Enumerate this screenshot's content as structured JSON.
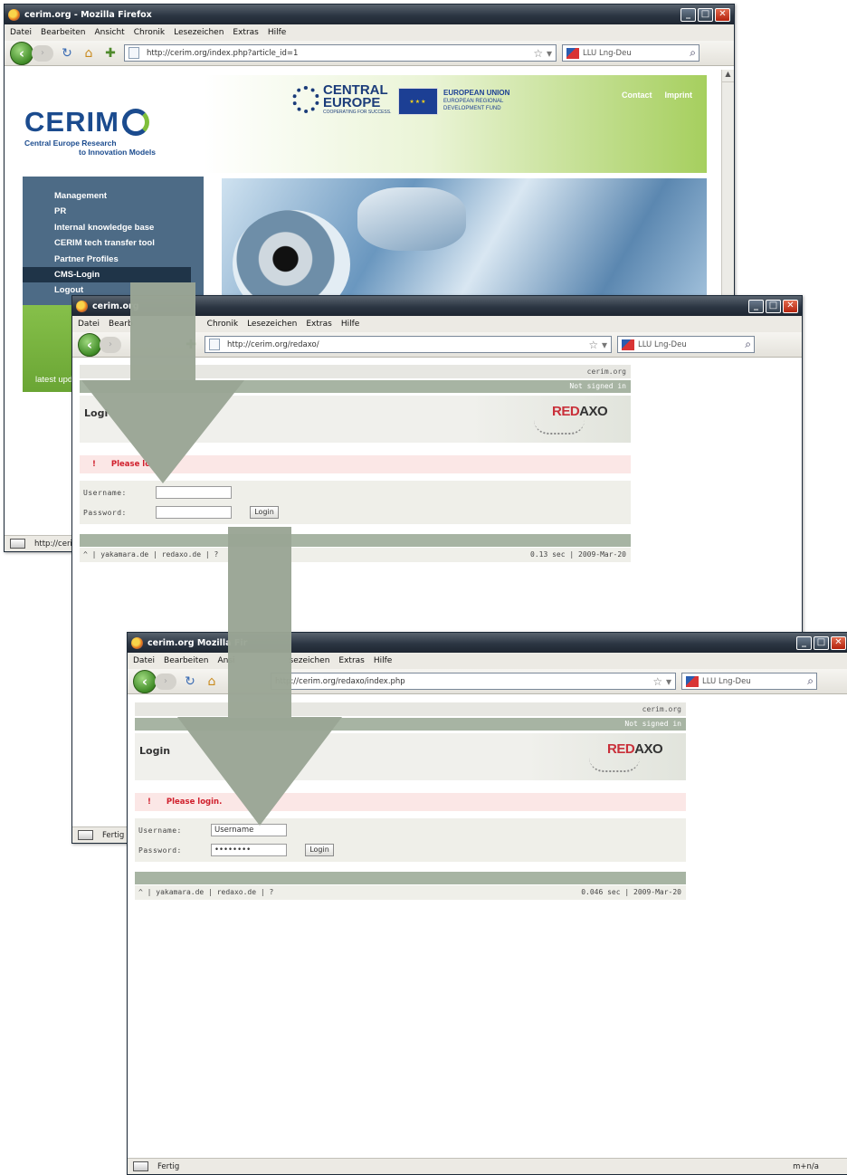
{
  "win1": {
    "title": "cerim.org - Mozilla Firefox",
    "menu": [
      "Datei",
      "Bearbeiten",
      "Ansicht",
      "Chronik",
      "Lesezeichen",
      "Extras",
      "Hilfe"
    ],
    "url": "http://cerim.org/index.php?article_id=1",
    "search": "LLU Lng-Deu",
    "status": "http://cerim",
    "page": {
      "logo_big": "CERIM",
      "logo_line1": "Central Europe Research",
      "logo_line2": "to Innovation Models",
      "ce_big": "CENTRAL",
      "ce_big2": "EUROPE",
      "ce_small": "COOPERATING FOR SUCCESS.",
      "eu_title": "EUROPEAN UNION",
      "eu_line1": "EUROPEAN REGIONAL",
      "eu_line2": "DEVELOPMENT FUND",
      "link_contact": "Contact",
      "link_imprint": "Imprint",
      "menu": [
        "Management",
        "PR",
        "Internal knowledge base",
        "CERIM tech transfer tool",
        "Partner Profiles",
        "CMS-Login",
        "Logout"
      ],
      "latest": "latest upd"
    }
  },
  "win2": {
    "title": "cerim.org",
    "menu": [
      "Datei",
      "Bearb",
      "Chronik",
      "Lesezeichen",
      "Extras",
      "Hilfe"
    ],
    "url": "http://cerim.org/redaxo/",
    "search": "LLU Lng-Deu",
    "status": "Fertig",
    "page": {
      "site": "cerim.org",
      "signed": "Not signed in",
      "heading": "Logi",
      "logo_red": "RED",
      "logo_dark": "AXO",
      "warn": "Please lo",
      "user_label": "Username:",
      "user_value": "",
      "pass_label": "Password:",
      "pass_value": "",
      "login_btn": "Login",
      "footer_left": "^ | yakamara.de | redaxo.de | ?",
      "footer_right": "0.13 sec | 2009-Mar-20"
    }
  },
  "win3": {
    "title": "cerim.org  Mozilla Fir",
    "menu": [
      "Datei",
      "Bearbeiten",
      "Ansi",
      "sezeichen",
      "Extras",
      "Hilfe"
    ],
    "url": "http://cerim.org/redaxo/index.php",
    "search": "LLU Lng-Deu",
    "status": "Fertig",
    "status_right": "m+n/a",
    "page": {
      "site": "cerim.org",
      "signed": "Not signed in",
      "heading": "Login",
      "logo_red": "RED",
      "logo_dark": "AXO",
      "warn": "Please login.",
      "user_label": "Username:",
      "user_value": "Username",
      "pass_label": "Password:",
      "pass_value": "••••••••",
      "login_btn": "Login",
      "footer_left": "^ | yakamara.de | redaxo.de | ?",
      "footer_right": "0.046 sec | 2009-Mar-20"
    }
  },
  "colors": {
    "arrow": "#9aa595",
    "cerim_blue": "#1b4b8e",
    "menu_bg": "#4d6b86",
    "green": "#7fbf3b",
    "warn_red": "#d01f2c"
  }
}
